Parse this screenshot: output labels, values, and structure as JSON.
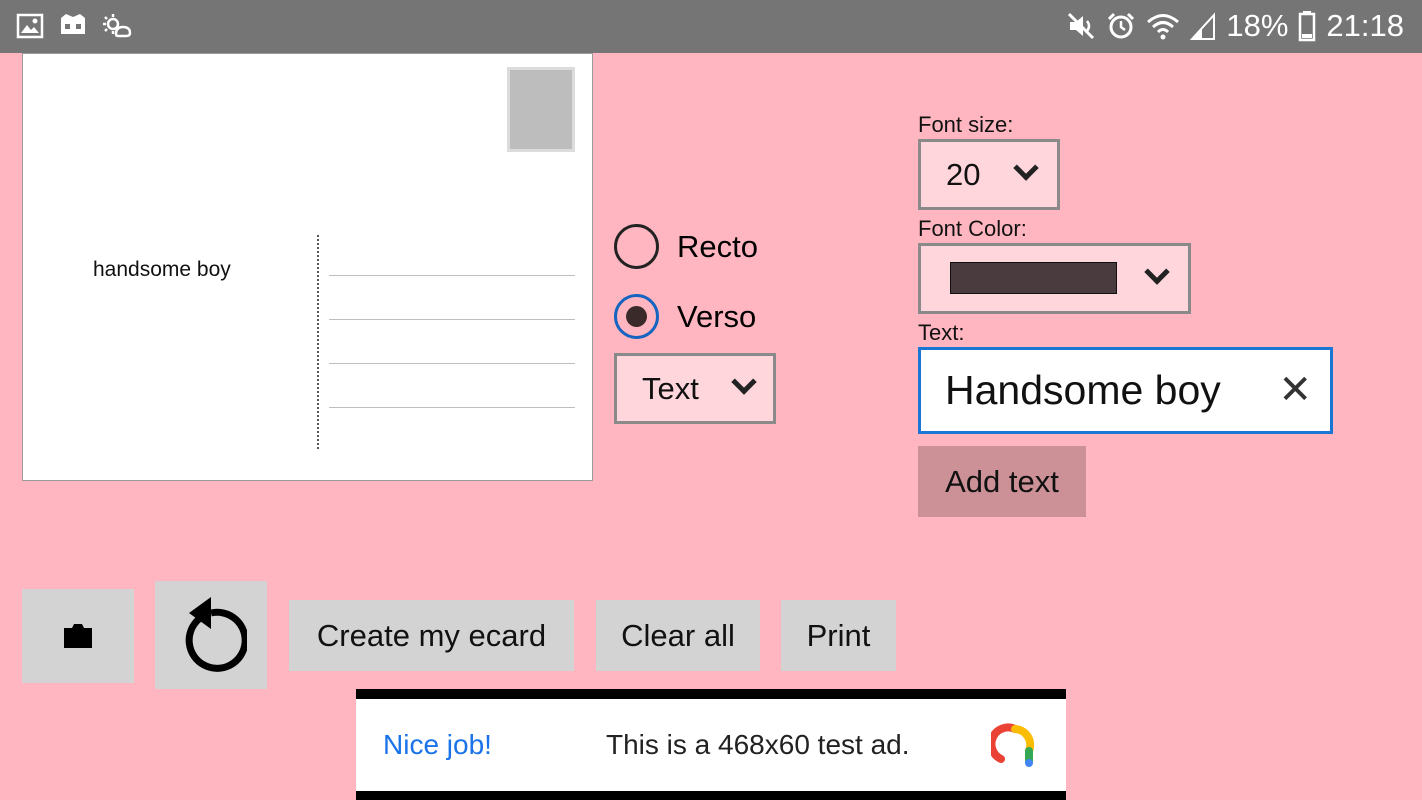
{
  "status_bar": {
    "battery_percent": "18%",
    "time": "21:18"
  },
  "postcard": {
    "text": "handsome boy"
  },
  "side": {
    "options": [
      "Recto",
      "Verso"
    ],
    "selected": "Verso"
  },
  "element_type": {
    "selected": "Text"
  },
  "font_size": {
    "label": "Font size:",
    "selected": "20"
  },
  "font_color": {
    "label": "Font Color:",
    "selected_color": "#4a3b3f"
  },
  "text_field": {
    "label": "Text:",
    "value": "Handsome boy"
  },
  "buttons": {
    "add_text": "Add text",
    "create": "Create my ecard",
    "clear_all": "Clear all",
    "print": "Print"
  },
  "ad": {
    "headline": "Nice job!",
    "body": "This is a 468x60 test ad."
  },
  "colors": {
    "background": "#ffb6c1",
    "status_bar": "#757575",
    "accent": "#1976d2"
  }
}
